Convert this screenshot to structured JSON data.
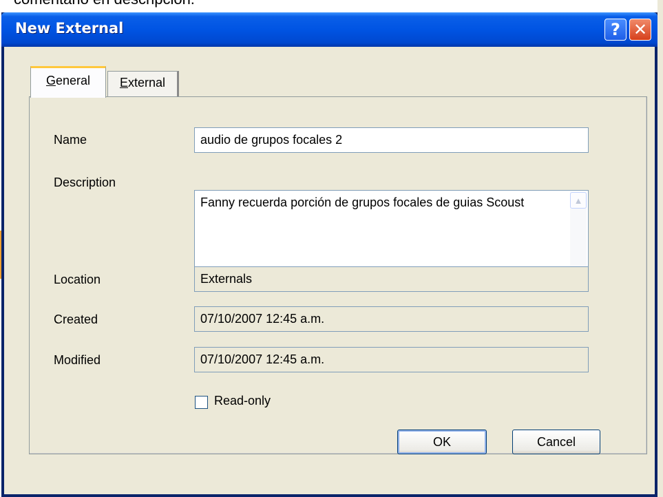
{
  "background": {
    "caption": "comentario en descripcion."
  },
  "window": {
    "title": "New External",
    "help_glyph": "?",
    "close_glyph": "✕"
  },
  "tabs": [
    {
      "label": "General",
      "underline": "G",
      "rest": "eneral"
    },
    {
      "label": "External",
      "underline": "E",
      "rest": "xternal"
    }
  ],
  "form": {
    "name": {
      "label": "Name",
      "value": "audio de grupos focales 2"
    },
    "description": {
      "label": "Description",
      "value": "Fanny recuerda porción de grupos focales de guias Scoust"
    },
    "location": {
      "label": "Location",
      "value": "Externals"
    },
    "created": {
      "label": "Created",
      "value": "07/10/2007 12:45 a.m."
    },
    "modified": {
      "label": "Modified",
      "value": "07/10/2007 12:45 a.m."
    },
    "read_only": {
      "label": "Read-only",
      "checked": false
    }
  },
  "buttons": {
    "ok": "OK",
    "cancel": "Cancel"
  },
  "icons": {
    "help": "help-icon",
    "close": "close-icon",
    "scroll_up": "scroll-up-icon",
    "scroll_down": "scroll-down-icon"
  },
  "colors": {
    "titlebar": "#0054e3",
    "face": "#ece9d8",
    "close": "#d6401c"
  }
}
